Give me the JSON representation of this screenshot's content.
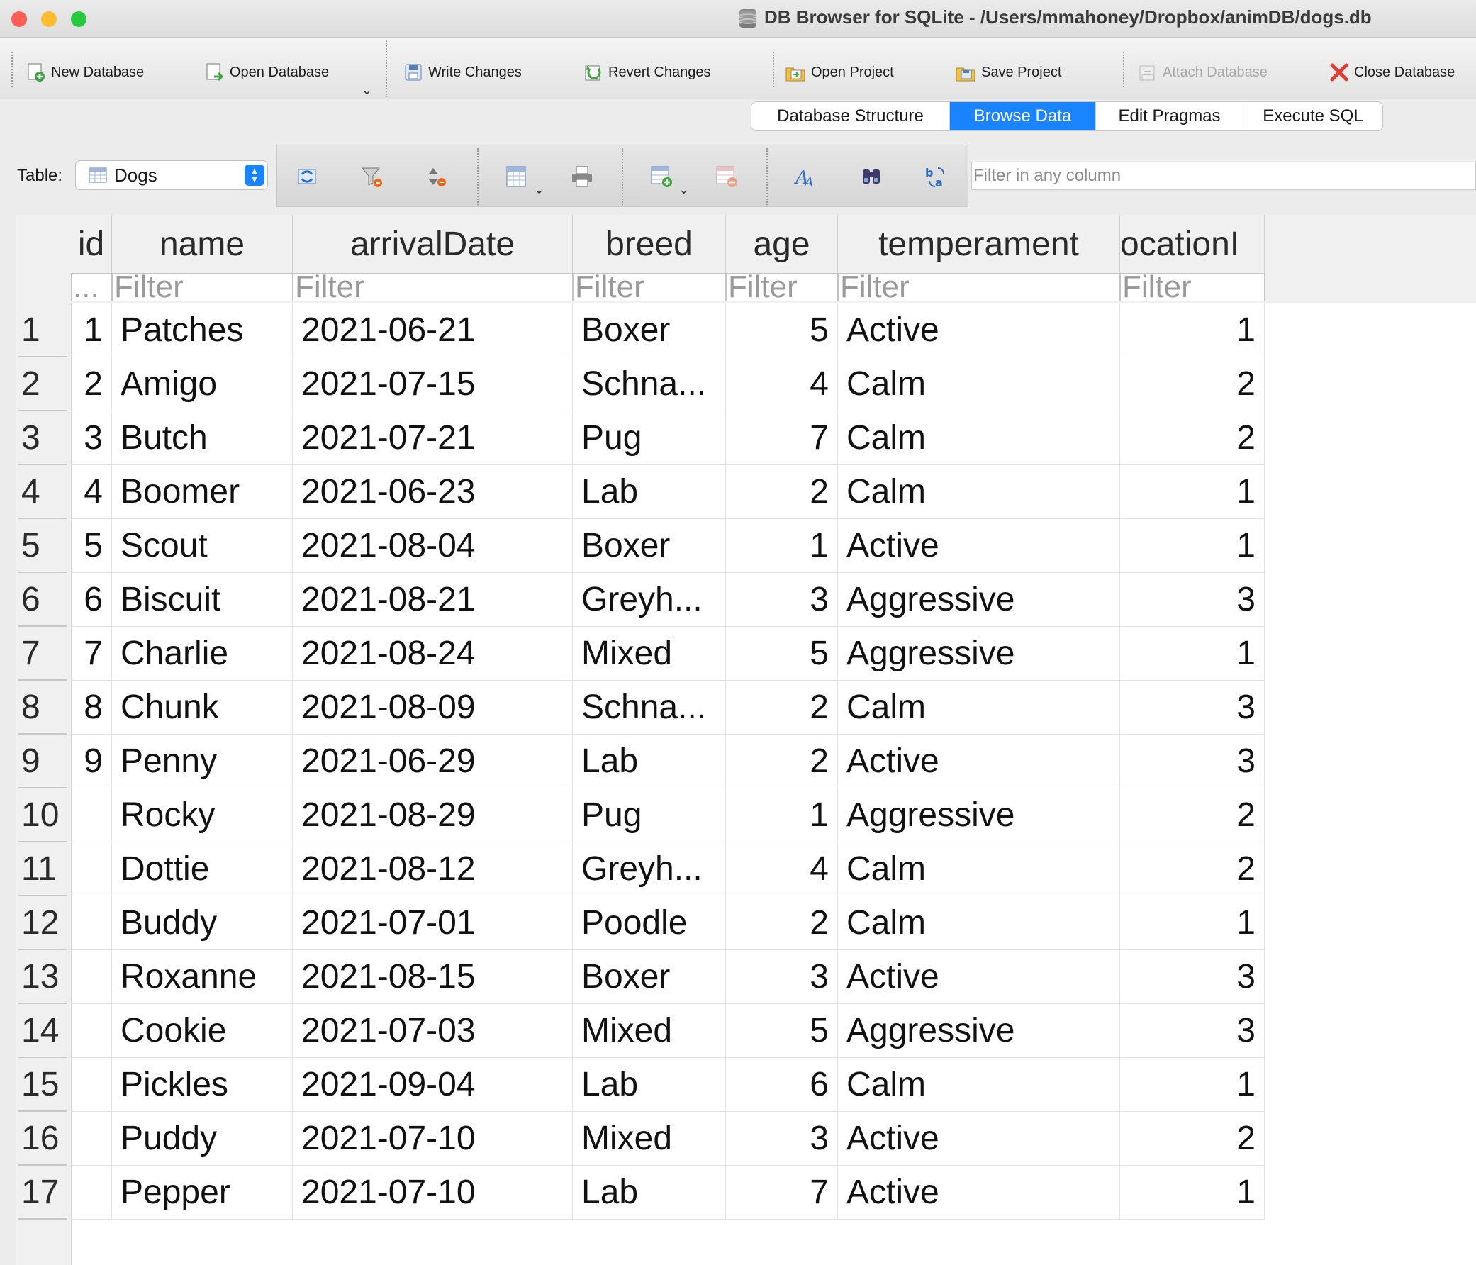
{
  "window": {
    "title": "DB Browser for SQLite - /Users/mmahoney/Dropbox/animDB/dogs.db"
  },
  "toolbar": {
    "new_database": "New Database",
    "open_database": "Open Database",
    "write_changes": "Write Changes",
    "revert_changes": "Revert Changes",
    "open_project": "Open Project",
    "save_project": "Save Project",
    "attach_database": "Attach Database",
    "close_database": "Close Database"
  },
  "tabs": [
    {
      "label": "Database Structure",
      "active": false
    },
    {
      "label": "Browse Data",
      "active": true
    },
    {
      "label": "Edit Pragmas",
      "active": false
    },
    {
      "label": "Execute SQL",
      "active": false
    }
  ],
  "browse": {
    "table_label": "Table:",
    "table_selected": "Dogs",
    "filter_any_placeholder": "Filter in any column"
  },
  "grid": {
    "columns": [
      "id",
      "name",
      "arrivalDate",
      "breed",
      "age",
      "temperament",
      "ocationI"
    ],
    "filter_placeholder": "Filter",
    "id_filter_placeholder": "...",
    "rows": [
      {
        "rownum": "1",
        "cells": [
          "1",
          "Patches",
          "2021-06-21",
          "Boxer",
          "5",
          "Active",
          "1"
        ]
      },
      {
        "rownum": "2",
        "cells": [
          "2",
          "Amigo",
          "2021-07-15",
          "Schna...",
          "4",
          "Calm",
          "2"
        ]
      },
      {
        "rownum": "3",
        "cells": [
          "3",
          "Butch",
          "2021-07-21",
          "Pug",
          "7",
          "Calm",
          "2"
        ]
      },
      {
        "rownum": "4",
        "cells": [
          "4",
          "Boomer",
          "2021-06-23",
          "Lab",
          "2",
          "Calm",
          "1"
        ]
      },
      {
        "rownum": "5",
        "cells": [
          "5",
          "Scout",
          "2021-08-04",
          "Boxer",
          "1",
          "Active",
          "1"
        ]
      },
      {
        "rownum": "6",
        "cells": [
          "6",
          "Biscuit",
          "2021-08-21",
          "Greyh...",
          "3",
          "Aggressive",
          "3"
        ]
      },
      {
        "rownum": "7",
        "cells": [
          "7",
          "Charlie",
          "2021-08-24",
          "Mixed",
          "5",
          "Aggressive",
          "1"
        ]
      },
      {
        "rownum": "8",
        "cells": [
          "8",
          "Chunk",
          "2021-08-09",
          "Schna...",
          "2",
          "Calm",
          "3"
        ]
      },
      {
        "rownum": "9",
        "cells": [
          "9",
          "Penny",
          "2021-06-29",
          "Lab",
          "2",
          "Active",
          "3"
        ]
      },
      {
        "rownum": "10",
        "cells": [
          "",
          "Rocky",
          "2021-08-29",
          "Pug",
          "1",
          "Aggressive",
          "2"
        ]
      },
      {
        "rownum": "11",
        "cells": [
          "",
          "Dottie",
          "2021-08-12",
          "Greyh...",
          "4",
          "Calm",
          "2"
        ]
      },
      {
        "rownum": "12",
        "cells": [
          "",
          "Buddy",
          "2021-07-01",
          "Poodle",
          "2",
          "Calm",
          "1"
        ]
      },
      {
        "rownum": "13",
        "cells": [
          "",
          "Roxanne",
          "2021-08-15",
          "Boxer",
          "3",
          "Active",
          "3"
        ]
      },
      {
        "rownum": "14",
        "cells": [
          "",
          "Cookie",
          "2021-07-03",
          "Mixed",
          "5",
          "Aggressive",
          "3"
        ]
      },
      {
        "rownum": "15",
        "cells": [
          "",
          "Pickles",
          "2021-09-04",
          "Lab",
          "6",
          "Calm",
          "1"
        ]
      },
      {
        "rownum": "16",
        "cells": [
          "",
          "Puddy",
          "2021-07-10",
          "Mixed",
          "3",
          "Active",
          "2"
        ]
      },
      {
        "rownum": "17",
        "cells": [
          "",
          "Pepper",
          "2021-07-10",
          "Lab",
          "7",
          "Active",
          "1"
        ]
      }
    ]
  },
  "colors": {
    "accent": "#1a84ff",
    "close_red": "#ff5f57",
    "minimize_yellow": "#febc2e",
    "zoom_green": "#28c840"
  }
}
